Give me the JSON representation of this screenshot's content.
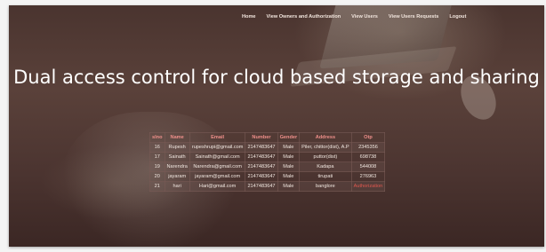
{
  "nav": {
    "items": [
      {
        "label": "Home"
      },
      {
        "label": "View Owners and Authorization"
      },
      {
        "label": "View Users"
      },
      {
        "label": "View Users Requests"
      },
      {
        "label": "Logout"
      }
    ]
  },
  "hero": {
    "title": "Dual access control for cloud based storage and sharing"
  },
  "table": {
    "headers": [
      "slno",
      "Name",
      "Email",
      "Number",
      "Gender",
      "Address",
      "Otp"
    ],
    "rows": [
      [
        "16",
        "Rupesh",
        "rupeshrupi@gmail.com",
        "2147483647",
        "Male",
        "Piler, chittor(dist), A.P",
        "2345356"
      ],
      [
        "17",
        "Sainath",
        "Sainath@gmail.com",
        "2147483647",
        "Male",
        "puttor(dist)",
        "698738"
      ],
      [
        "19",
        "Narendra",
        "Narendra@gmail.com",
        "2147483647",
        "Male",
        "Kadapa",
        "544008"
      ],
      [
        "20",
        "jayaram",
        "jayaram@gmail.com",
        "2147483647",
        "Male",
        "tirupati",
        "276963"
      ],
      [
        "21",
        "hari",
        "Hari@gmail.com",
        "2147483647",
        "Male",
        "banglore",
        "Authorization"
      ]
    ]
  }
}
